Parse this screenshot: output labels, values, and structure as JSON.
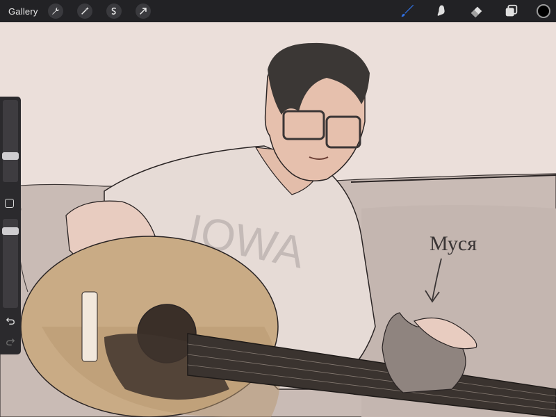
{
  "topbar": {
    "gallery_label": "Gallery",
    "left_tools": [
      {
        "name": "actions-wrench-icon"
      },
      {
        "name": "adjustments-wand-icon"
      },
      {
        "name": "selection-s-icon"
      },
      {
        "name": "transform-arrow-icon"
      }
    ],
    "right_tools": [
      {
        "name": "brush-icon",
        "active": true
      },
      {
        "name": "smudge-icon"
      },
      {
        "name": "eraser-icon"
      },
      {
        "name": "layers-icon"
      }
    ],
    "current_color": "#000000",
    "active_tool_color": "#2f6fe0"
  },
  "sidebar": {
    "brush_size_fraction": 0.3,
    "opacity_fraction": 0.9
  },
  "canvas": {
    "annotation_text": "Муся",
    "shirt_text": "IOWA",
    "background_color": "#ebdfda",
    "couch_color": "#c8bab4"
  }
}
